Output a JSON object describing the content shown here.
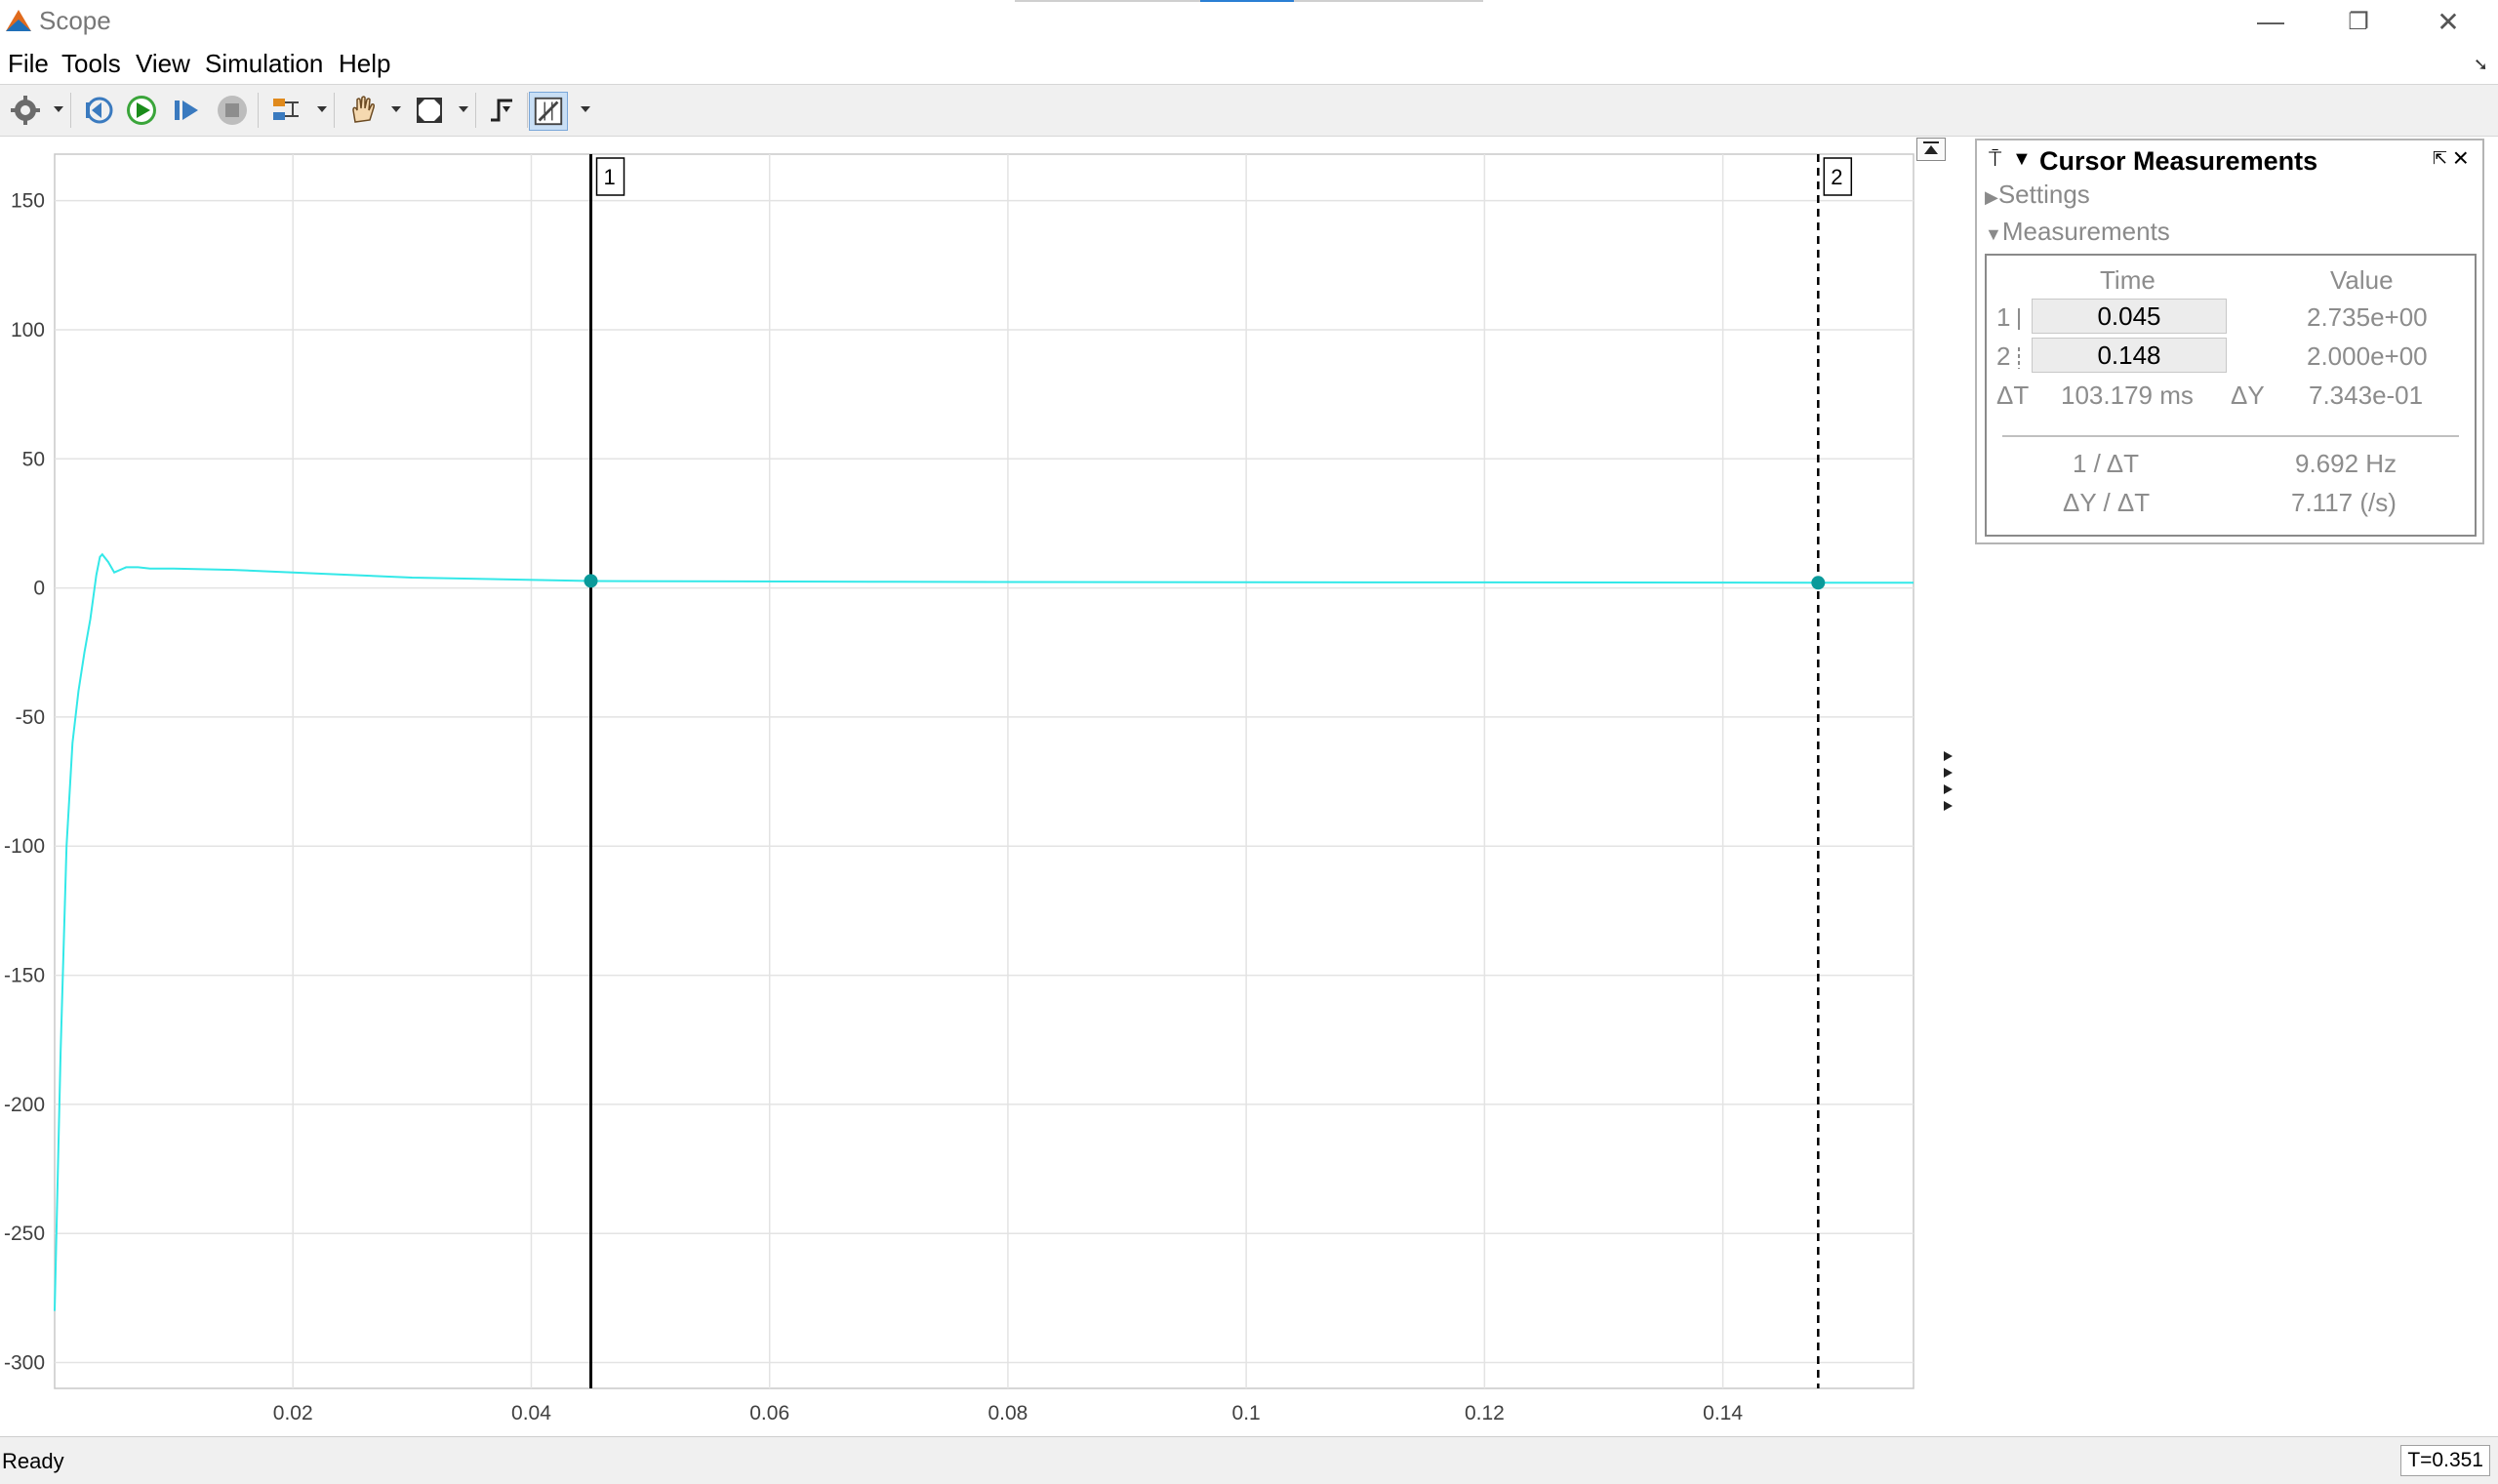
{
  "window": {
    "title": "Scope",
    "minimize_label": "—",
    "restore_label": "❐",
    "close_label": "✕"
  },
  "menu": {
    "items": [
      "File",
      "Tools",
      "View",
      "Simulation",
      "Help"
    ]
  },
  "toolbar": {
    "icons": [
      "gear-icon",
      "step-back-icon",
      "run-icon",
      "step-forward-icon",
      "stop-icon",
      "signal-selector-icon",
      "pan-icon",
      "zoom-fit-icon",
      "triggers-icon",
      "cursor-measurements-icon"
    ]
  },
  "plot": {
    "cursor1_label": "1",
    "cursor2_label": "2",
    "line_color": "#33e8e8",
    "marker_color": "#0a9a9a"
  },
  "chart_data": {
    "type": "line",
    "xlim": [
      0,
      0.156
    ],
    "ylim": [
      -310,
      168
    ],
    "yticks": [
      150,
      100,
      50,
      0,
      -50,
      -100,
      -150,
      -200,
      -250,
      -300
    ],
    "ytick_labels": [
      "150",
      "100",
      "50",
      "0",
      "-50",
      "-100",
      "-150",
      "-200",
      "-250",
      "-300"
    ],
    "xticks": [
      0.02,
      0.04,
      0.06,
      0.08,
      0.1,
      0.12,
      0.14
    ],
    "xtick_labels": [
      "0.02",
      "0.04",
      "0.06",
      "0.08",
      "0.1",
      "0.12",
      "0.14"
    ],
    "grid": true,
    "x": [
      0,
      0.0005,
      0.001,
      0.0015,
      0.002,
      0.0025,
      0.003,
      0.0035,
      0.0038,
      0.004,
      0.0045,
      0.005,
      0.006,
      0.007,
      0.008,
      0.01,
      0.015,
      0.02,
      0.03,
      0.045,
      0.07,
      0.1,
      0.13,
      0.148,
      0.156
    ],
    "y": [
      -280,
      -180,
      -100,
      -60,
      -40,
      -25,
      -12,
      5,
      12,
      13,
      10,
      6,
      8,
      8,
      7.5,
      7.5,
      7,
      6,
      4,
      2.7,
      2.4,
      2.2,
      2.1,
      2.0,
      2.0
    ],
    "cursors": [
      {
        "label": "1",
        "x": 0.045,
        "y": 2.735,
        "style": "solid"
      },
      {
        "label": "2",
        "x": 0.148,
        "y": 2.0,
        "style": "dashed"
      }
    ]
  },
  "panel": {
    "title": "Cursor Measurements",
    "settings_label": "Settings",
    "measurements_label": "Measurements",
    "header_time": "Time",
    "header_value": "Value",
    "rows": [
      {
        "id": "1",
        "time": "0.045",
        "value": "2.735e+00"
      },
      {
        "id": "2",
        "time": "0.148",
        "value": "2.000e+00"
      }
    ],
    "dt_label": "ΔT",
    "dt_value": "103.179 ms",
    "dy_label": "ΔY",
    "dy_value": "7.343e-01",
    "inv_dt_label": "1 / ΔT",
    "inv_dt_value": "9.692 Hz",
    "dydt_label": "ΔY / ΔT",
    "dydt_value": "7.117 (/s)"
  },
  "status": {
    "text": "Ready",
    "time": "T=0.351"
  }
}
